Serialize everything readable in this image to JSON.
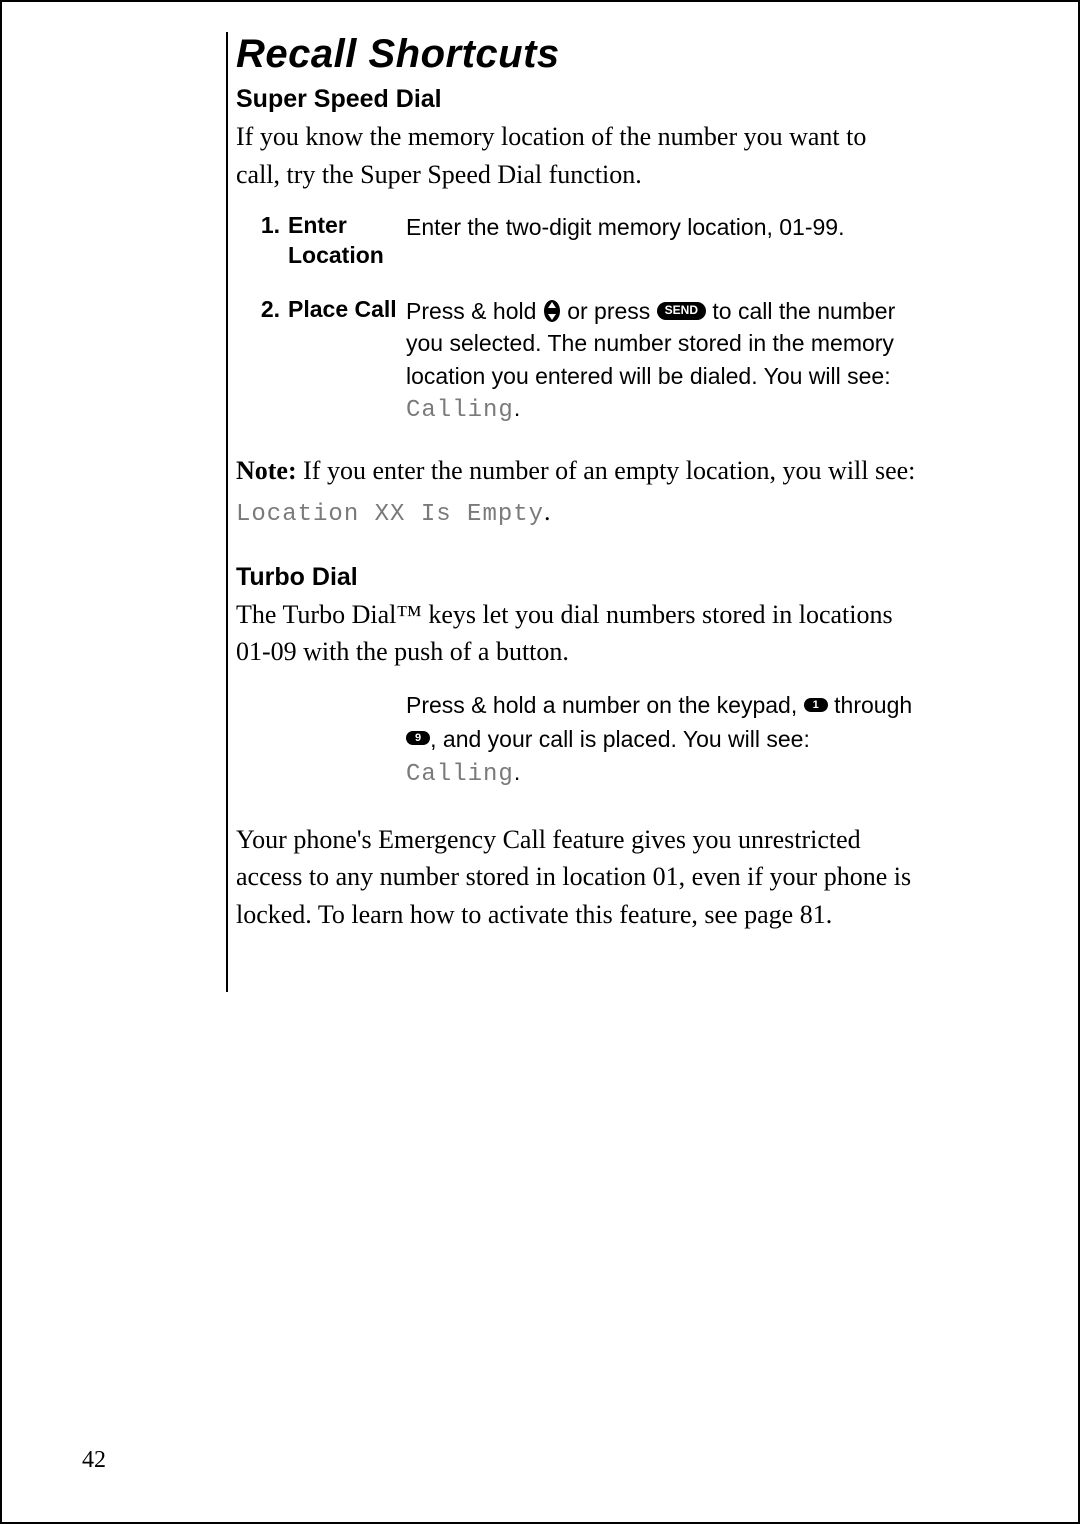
{
  "title": "Recall Shortcuts",
  "section1": {
    "heading": "Super Speed Dial",
    "intro": "If you know the memory location of the number you want to call, try the Super Speed Dial function."
  },
  "steps": [
    {
      "num": "1.",
      "label": "Enter Location",
      "desc": "Enter the two-digit memory location, 01-99."
    },
    {
      "num": "2.",
      "label": "Place Call",
      "desc_pre": "Press & hold ",
      "desc_mid": " or press ",
      "desc_post1": " to call the num­ber you selected. The number stored in the memory location you entered will be dialed. You will see: ",
      "lcd": "Calling",
      "desc_post2": "."
    }
  ],
  "note": {
    "label": "Note:",
    "text_pre": " If you enter the number of an empty location, you will see: ",
    "lcd": "Location XX Is Empty",
    "text_post": "."
  },
  "section2": {
    "heading": "Turbo Dial",
    "intro": "The Turbo Dial™ keys let you dial numbers stored in locations 01-09 with the push of a button."
  },
  "turbo_step": {
    "pre": "Press & hold a number on the keypad, ",
    "mid": " through ",
    "post_pre": ", and your call is placed. You will see: ",
    "lcd": "Calling",
    "post_post": "."
  },
  "footer_para": "Your phone's Emergency Call feature gives you unrestricted access to any number stored in location 01, even if your phone is locked. To learn how to activate this feature, see page 81.",
  "icons": {
    "send": "SEND",
    "key1": "1",
    "key9": "9"
  },
  "page_number": "42"
}
